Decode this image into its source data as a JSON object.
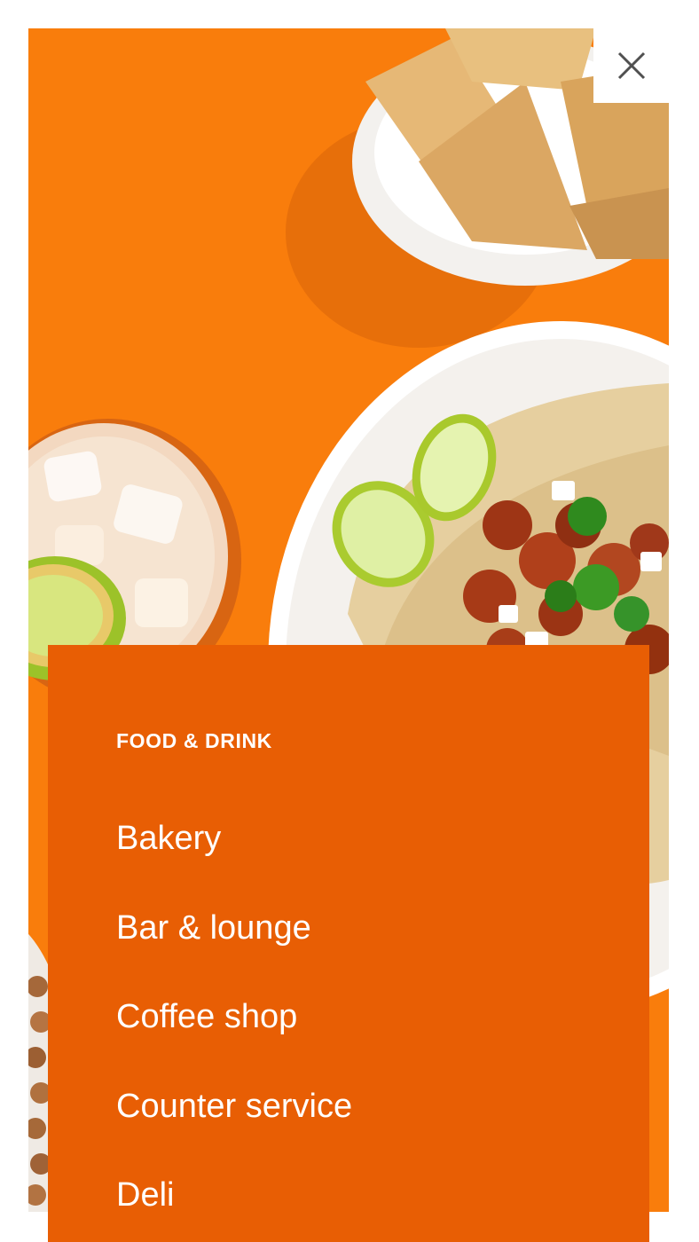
{
  "close": {
    "icon": "close-icon"
  },
  "menu": {
    "heading": "FOOD & DRINK",
    "items": [
      {
        "label": "Bakery"
      },
      {
        "label": "Bar & lounge"
      },
      {
        "label": "Coffee shop"
      },
      {
        "label": "Counter service"
      },
      {
        "label": "Deli"
      }
    ]
  },
  "colors": {
    "hero_background": "#f97d0c",
    "menu_panel": "#e85e04",
    "text": "#ffffff"
  }
}
